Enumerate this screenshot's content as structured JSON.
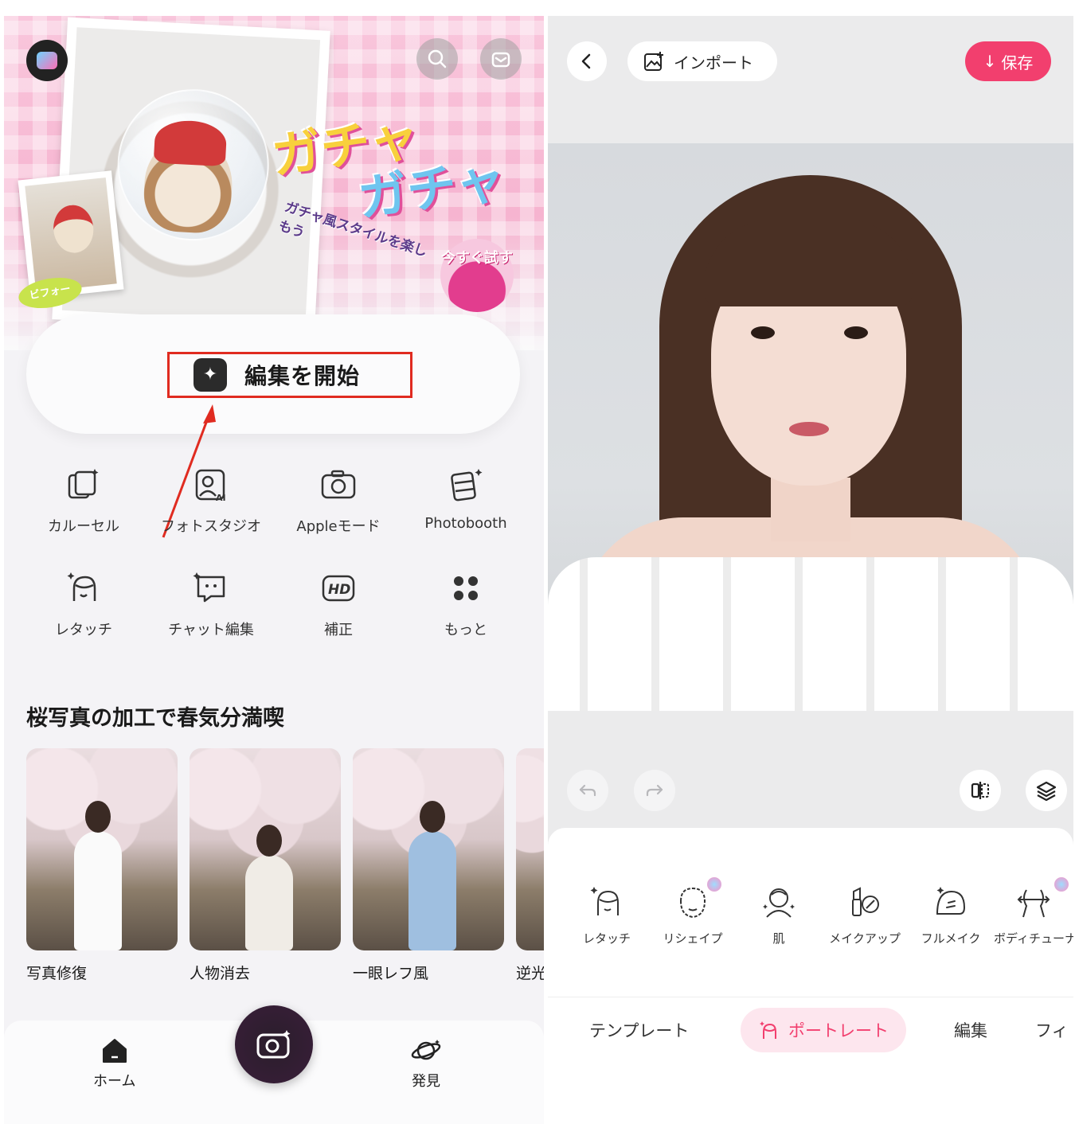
{
  "left": {
    "banner": {
      "title_line1": "ガチャ",
      "title_line2": "ガチャ",
      "subtitle": "ガチャ風スタイルを楽しもう",
      "try_now": "今すぐ試す",
      "before_badge": "ビフォー"
    },
    "start_button": "編集を開始",
    "tools": [
      {
        "label": "カルーセル",
        "icon": "carousel-icon"
      },
      {
        "label": "フォトスタジオ",
        "icon": "photo-studio-icon"
      },
      {
        "label": "Appleモード",
        "icon": "camera-icon"
      },
      {
        "label": "Photobooth",
        "icon": "photobooth-icon"
      },
      {
        "label": "レタッチ",
        "icon": "retouch-icon"
      },
      {
        "label": "チャット編集",
        "icon": "chat-edit-icon"
      },
      {
        "label": "補正",
        "icon": "hd-icon"
      },
      {
        "label": "もっと",
        "icon": "more-icon"
      }
    ],
    "section_title": "桜写真の加工で春気分満喫",
    "cards": [
      {
        "label": "写真修復"
      },
      {
        "label": "人物消去"
      },
      {
        "label": "一眼レフ風"
      },
      {
        "label": "逆光"
      }
    ],
    "nav": {
      "home": "ホーム",
      "discover": "発見"
    }
  },
  "right": {
    "import_label": "インポート",
    "save_label": "保存",
    "tools": [
      {
        "label": "レタッチ",
        "premium": false
      },
      {
        "label": "リシェイプ",
        "premium": true
      },
      {
        "label": "肌",
        "premium": false
      },
      {
        "label": "メイクアップ",
        "premium": false
      },
      {
        "label": "フルメイク",
        "premium": false
      },
      {
        "label": "ボディチューナー",
        "premium": true
      }
    ],
    "tabs": {
      "template": "テンプレート",
      "portrait": "ポートレート",
      "edit": "編集",
      "filter": "フィ"
    }
  },
  "colors": {
    "accent": "#f23f6e",
    "highlight_box": "#e02b20"
  }
}
